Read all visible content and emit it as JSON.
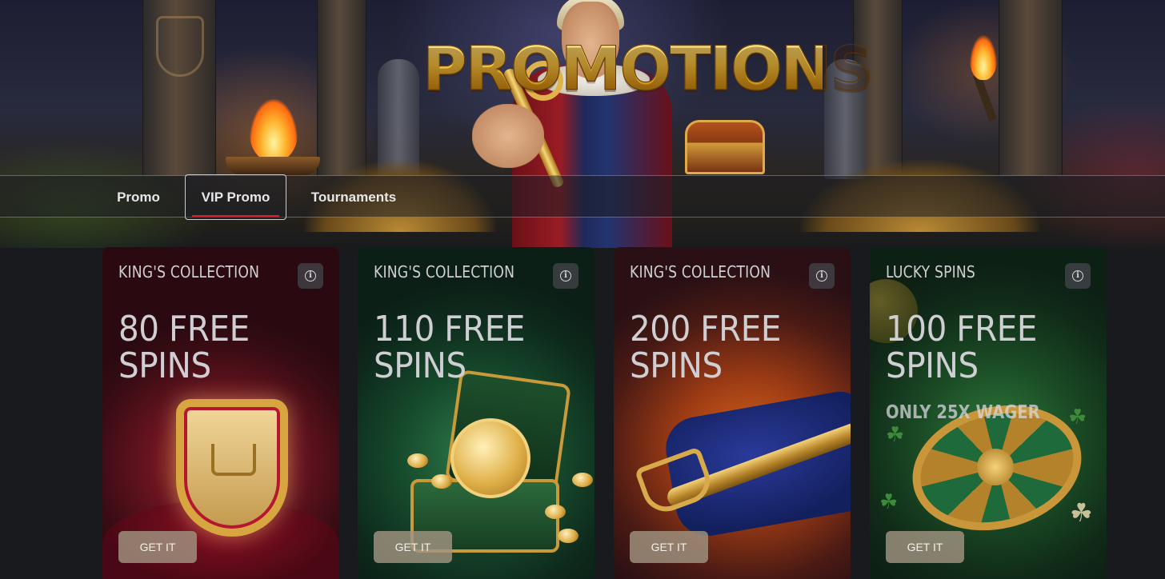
{
  "hero": {
    "title": "PROMOTIONS"
  },
  "tabs": [
    {
      "label": "Promo",
      "active": false
    },
    {
      "label": "VIP Promo",
      "active": true
    },
    {
      "label": "Tournaments",
      "active": false
    }
  ],
  "cards": [
    {
      "kicker": "KING'S COLLECTION",
      "amount_line1": "80 FREE",
      "amount_line2": "SPINS",
      "subtitle": "",
      "button": "GET IT",
      "info_icon": "info-icon",
      "illustration": "royal-shield-crown"
    },
    {
      "kicker": "KING'S COLLECTION",
      "amount_line1": "110 FREE",
      "amount_line2": "SPINS",
      "subtitle": "",
      "button": "GET IT",
      "info_icon": "info-icon",
      "illustration": "coin-in-velvet-box"
    },
    {
      "kicker": "KING'S COLLECTION",
      "amount_line1": "200 FREE",
      "amount_line2": "SPINS",
      "subtitle": "",
      "button": "GET IT",
      "info_icon": "info-icon",
      "illustration": "scepter-on-pillow"
    },
    {
      "kicker": "LUCKY SPINS",
      "amount_line1": "100 FREE",
      "amount_line2": "SPINS",
      "subtitle": "ONLY 25X WAGER",
      "button": "GET IT",
      "info_icon": "info-icon",
      "illustration": "fortune-wheel-clovers"
    }
  ],
  "colors": {
    "page_bg": "#191a1d",
    "active_tab_underline": "#d8202c",
    "button_bg": "#a0947f",
    "title_gold": "#f5c642"
  }
}
